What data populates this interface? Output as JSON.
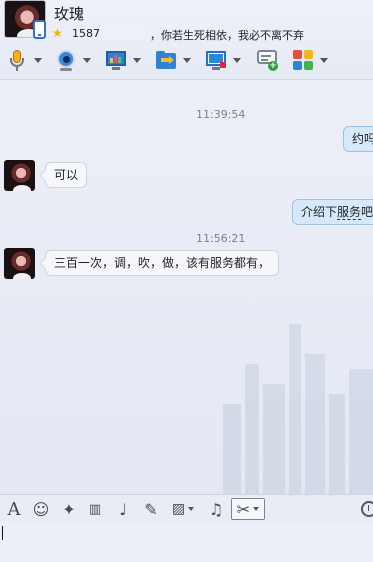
{
  "contact": {
    "name": "玫瑰",
    "id_prefix": "1587",
    "signature": "，你若生死相依，我必不离不弃"
  },
  "toolbar": {
    "items": [
      {
        "name": "voice-call",
        "icon": "microphone-icon"
      },
      {
        "name": "video-call",
        "icon": "webcam-icon"
      },
      {
        "name": "share-screen",
        "icon": "screen-share-icon"
      },
      {
        "name": "send-file",
        "icon": "folder-transfer-icon"
      },
      {
        "name": "remote-desktop",
        "icon": "remote-desktop-icon"
      },
      {
        "name": "group-chat",
        "icon": "add-chat-icon"
      },
      {
        "name": "apps",
        "icon": "apps-icon"
      }
    ]
  },
  "messages": {
    "time1": "11:39:54",
    "msg1_right": "约吗",
    "msg2_left": "可以",
    "msg3_right_a": "介绍下",
    "msg3_right_b": "服务",
    "msg3_right_c": "吧",
    "time2": "11:56:21",
    "msg4_left": "三百一次，调，吹，做，该有服务都有，"
  },
  "input_toolbar": {
    "items": [
      "font",
      "emoji",
      "magic",
      "video-clip",
      "voice",
      "edit",
      "image",
      "music",
      "screenshot",
      "history"
    ]
  },
  "colors": {
    "bubble_right": "#d6e9fa",
    "bubble_left": "#f6f7fb",
    "background": "#e9ecf5",
    "accent_star": "#f2b20f"
  }
}
